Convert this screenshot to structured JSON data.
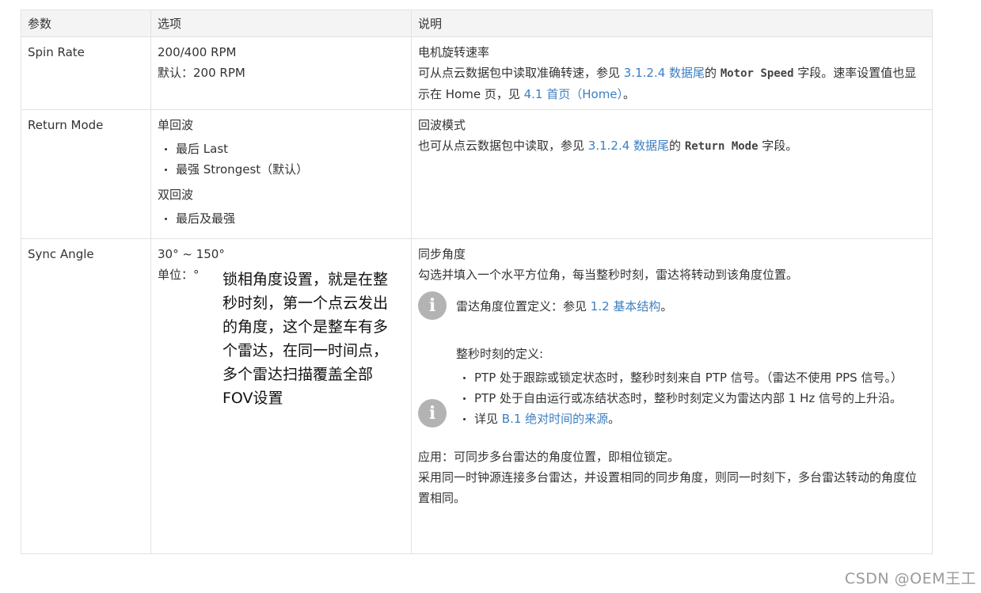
{
  "headers": [
    "参数",
    "选项",
    "说明"
  ],
  "row1": {
    "param": "Spin Rate",
    "opt_line1": "200/400 RPM",
    "opt_line2": "默认：200 RPM",
    "desc_title": "电机旋转速率",
    "desc_a": "可从点云数据包中读取准确转速，参见 ",
    "desc_link1": "3.1.2.4 数据尾",
    "desc_b": "的 ",
    "desc_code": "Motor Speed",
    "desc_c": " 字段。速率设置值也显示在 Home 页，见 ",
    "desc_link2": "4.1 首页（Home）",
    "desc_d": "。"
  },
  "row2": {
    "param": "Return Mode",
    "single_label": "单回波",
    "single_items": [
      "最后 Last",
      "最强 Strongest（默认）"
    ],
    "dual_label": "双回波",
    "dual_items": [
      "最后及最强"
    ],
    "desc_title": "回波模式",
    "desc_a": "也可从点云数据包中读取，参见 ",
    "desc_link": "3.1.2.4 数据尾",
    "desc_b": "的 ",
    "desc_code": "Return Mode",
    "desc_c": " 字段。"
  },
  "row3": {
    "param": "Sync Angle",
    "opt_line1": "30° ~ 150°",
    "opt_line2": "单位：°",
    "annotation": "锁相角度设置，就是在整秒时刻，第一个点云发出的角度，这个是整车有多个雷达，在同一时间点，多个雷达扫描覆盖全部FOV设置",
    "desc_title": "同步角度",
    "desc_line": "勾选并填入一个水平方位角，每当整秒时刻，雷达将转动到该角度位置。",
    "info1_a": "雷达角度位置定义：参见 ",
    "info1_link": "1.2 基本结构",
    "info1_b": "。",
    "info2_title": "整秒时刻的定义:",
    "info2_item1": "PTP 处于跟踪或锁定状态时，整秒时刻来自 PTP 信号。（雷达不使用 PPS 信号。）",
    "info2_item2": "PTP 处于自由运行或冻结状态时，整秒时刻定义为雷达内部 1 Hz 信号的上升沿。",
    "info2_item3_a": "详见 ",
    "info2_item3_link": "B.1 绝对时间的来源",
    "info2_item3_b": "。",
    "apply_line": "应用：可同步多台雷达的角度位置，即相位锁定。",
    "apply_line2": "采用同一时钟源连接多台雷达，并设置相同的同步角度，则同一时刻下，多台雷达转动的角度位置相同。",
    "info_icon": "info-circle-icon"
  },
  "watermark": "CSDN @OEM王工",
  "colors": {
    "link": "#3d7fc2",
    "header_bg": "#f4f4f4",
    "border": "#e2e2e2",
    "icon": "#b3b3b3"
  }
}
